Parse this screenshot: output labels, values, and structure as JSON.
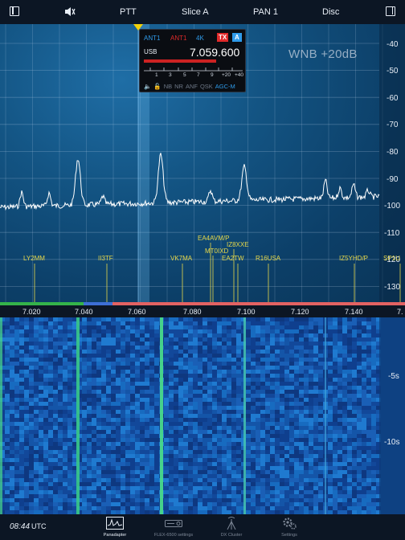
{
  "topbar": {
    "ptt": "PTT",
    "slice": "Slice A",
    "pan": "PAN 1",
    "disc": "Disc"
  },
  "slice_box": {
    "rx_ant": "ANT1",
    "tx_ant": "ANT1",
    "filter": "4K",
    "tx_badge": "TX",
    "slice_badge": "A",
    "mode": "USB",
    "frequency": "7.059.600",
    "smeter_labels": [
      "1",
      "3",
      "5",
      "7",
      "9",
      "+20",
      "+40"
    ],
    "dsp": [
      "NB",
      "NR",
      "ANF",
      "QSK",
      "AGC-M"
    ]
  },
  "wnb": "WNB  +20dB",
  "db_scale": [
    "-40",
    "-50",
    "-60",
    "-70",
    "-80",
    "-90",
    "-100",
    "-110",
    "-120",
    "-130"
  ],
  "freq_scale": [
    "7.020",
    "7.040",
    "7.060",
    "7.080",
    "7.100",
    "7.120",
    "7.140",
    "7."
  ],
  "spots": [
    {
      "call": "LY2MM"
    },
    {
      "call": "II3TF"
    },
    {
      "call": "VK7MA"
    },
    {
      "call": "EA4AVM/P"
    },
    {
      "call": "MT0IXD"
    },
    {
      "call": "IZ8XXE"
    },
    {
      "call": "EA2TW"
    },
    {
      "call": "R16USA"
    },
    {
      "call": "IZ5YHD/P"
    },
    {
      "call": "SP1U"
    }
  ],
  "waterfall_scale": [
    "-5s",
    "-10s"
  ],
  "clock": {
    "time": "08:44",
    "zone": "UTC"
  },
  "tabs": [
    "Panadapter",
    "FLEX-6500 settings",
    "DX Cluster",
    "Settings"
  ],
  "colors": {
    "accent": "#2f9bea",
    "tx": "#e02a2a",
    "spot": "#e6d84a",
    "slice_marker": "#f2d20a"
  }
}
